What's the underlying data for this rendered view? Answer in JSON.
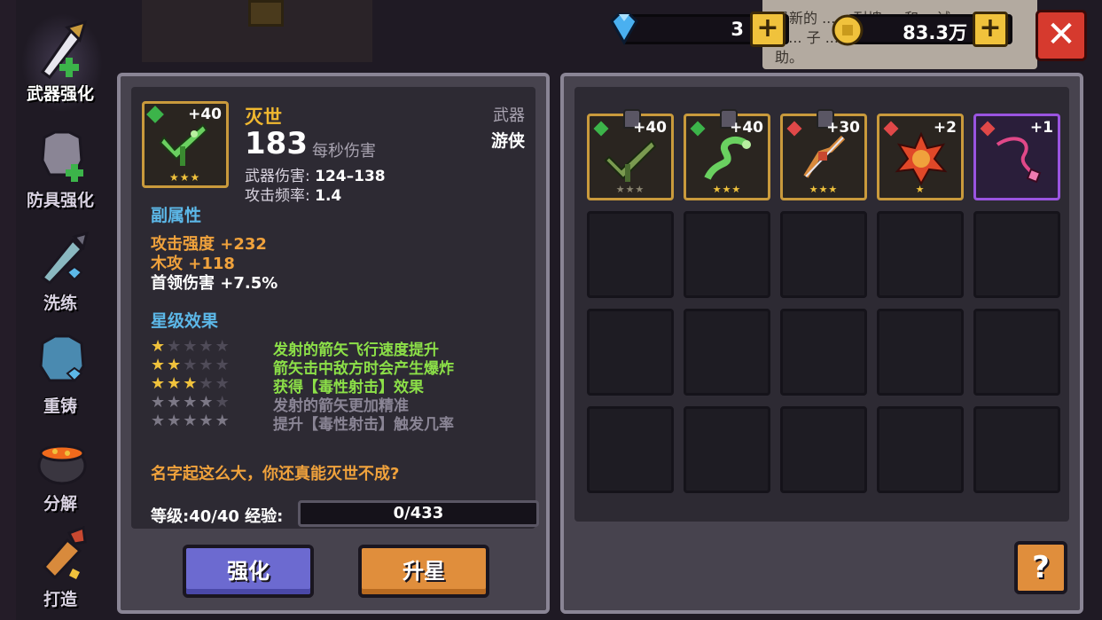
{
  "side_menu": {
    "items": [
      {
        "label": "武器强化",
        "icon": "sword-upgrade-icon",
        "active": true
      },
      {
        "label": "防具强化",
        "icon": "armor-upgrade-icon",
        "active": false
      },
      {
        "label": "洗练",
        "icon": "reforge-sword-icon",
        "active": false
      },
      {
        "label": "重铸",
        "icon": "armor-recast-icon",
        "active": false
      },
      {
        "label": "分解",
        "icon": "cauldron-icon",
        "active": false
      },
      {
        "label": "打造",
        "icon": "forge-hammer-icon",
        "active": false
      }
    ]
  },
  "currency": {
    "gems": "3",
    "gold": "83.3万",
    "plus_label": "+"
  },
  "tooltip": {
    "line1": "最新的 ...... 耐塊 ... 和... 试",
    "line2": "...... 子 ... 援",
    "line3": "助。"
  },
  "close_label": "✕",
  "weapon": {
    "level_tag": "+40",
    "name": "灭世",
    "type": "武器",
    "class": "游侠",
    "dps": "183",
    "dps_label": "每秒伤害",
    "damage_label": "武器伤害:",
    "damage_value": "124–138",
    "rate_label": "攻击频率:",
    "rate_value": "1.4",
    "stars_mini": "★★★"
  },
  "sub_attrs": {
    "title": "副属性",
    "items": [
      {
        "text": "攻击强度 +232",
        "color": "#f0a23c"
      },
      {
        "text": "木攻 +118",
        "color": "#f0a23c"
      },
      {
        "text": "首领伤害 +7.5%",
        "color": "#ffffff"
      }
    ]
  },
  "star_effects": {
    "title": "星级效果",
    "rows": [
      {
        "stars": 1,
        "unlocked": true,
        "desc": "发射的箭矢飞行速度提升"
      },
      {
        "stars": 2,
        "unlocked": true,
        "desc": "箭矢击中敌方时会产生爆炸"
      },
      {
        "stars": 3,
        "unlocked": true,
        "desc": "获得【毒性射击】效果"
      },
      {
        "stars": 4,
        "unlocked": false,
        "desc": "发射的箭矢更加精准"
      },
      {
        "stars": 5,
        "unlocked": false,
        "desc": "提升【毒性射击】触发几率"
      }
    ]
  },
  "flavor_text": "名字起这么大，你还真能灭世不成?",
  "level": {
    "label": "等级:40/40",
    "exp_label": "经验:",
    "exp_value": "0/433",
    "exp_progress": 0
  },
  "buttons": {
    "enhance": "强化",
    "upgrade_star": "升星",
    "help": "?"
  },
  "inventory": {
    "slots": [
      {
        "level": "+40",
        "tag": "green",
        "frame": "gold",
        "stars": "★★★",
        "stars_dim": true,
        "locked": true,
        "icon": "crossbow-icon"
      },
      {
        "level": "+40",
        "tag": "green",
        "frame": "gold",
        "stars": "★★★",
        "stars_dim": false,
        "locked": true,
        "icon": "serpent-bow-icon"
      },
      {
        "level": "+30",
        "tag": "red",
        "frame": "gold",
        "stars": "★★★",
        "stars_dim": false,
        "locked": true,
        "icon": "recurve-bow-icon"
      },
      {
        "level": "+2",
        "tag": "red",
        "frame": "gold",
        "stars": "★",
        "stars_dim": false,
        "locked": false,
        "icon": "fire-orb-icon"
      },
      {
        "level": "+1",
        "tag": "red",
        "frame": "purple",
        "stars": "",
        "stars_dim": false,
        "locked": false,
        "icon": "whip-icon"
      }
    ]
  }
}
